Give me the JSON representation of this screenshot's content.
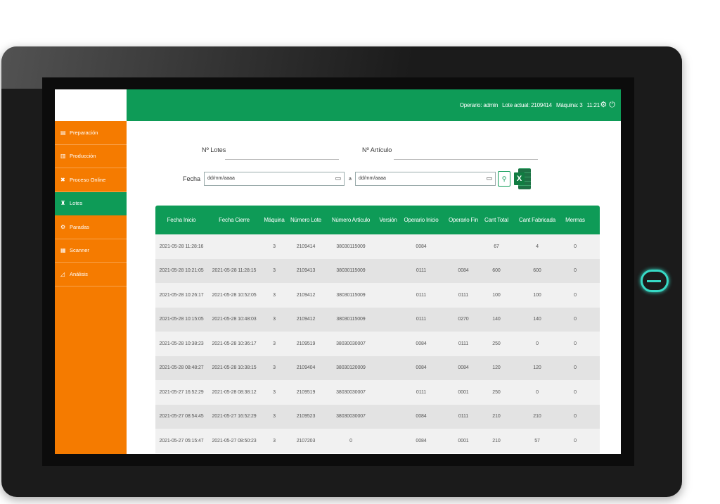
{
  "topbar": {
    "operator": "Operario: admin",
    "current_lot": "Lote actual: 2109414",
    "machine": "Máquina: 3",
    "time": "11:21",
    "settings_icon": "gear-icon",
    "power_icon": "power-icon"
  },
  "sidebar": {
    "items": [
      {
        "label": "Preparación",
        "icon": "file-icon"
      },
      {
        "label": "Producción",
        "icon": "bar-chart-icon"
      },
      {
        "label": "Proceso Online",
        "icon": "cross-icon"
      },
      {
        "label": "Lotes",
        "icon": "hierarchy-icon"
      },
      {
        "label": "Paradas",
        "icon": "gear-icon"
      },
      {
        "label": "Scanner",
        "icon": "barcode-icon"
      },
      {
        "label": "Análisis",
        "icon": "area-chart-icon"
      }
    ]
  },
  "filters": {
    "lotes_label": "Nº Lotes",
    "articulo_label": "Nº Artículo",
    "fecha_label": "Fecha",
    "date_from_placeholder": "dd/mm/aaaa",
    "separator": "a",
    "date_to_placeholder": "dd/mm/aaaa"
  },
  "table": {
    "headers": [
      "Fecha Inicio",
      "Fecha Cierre",
      "Máquina",
      "Número Lote",
      "Número Artículo",
      "Versión",
      "Operario Inicio",
      "Operario Fin",
      "Cant Total",
      "Cant Fabricada",
      "Mermas"
    ],
    "rows": [
      [
        "2021-05-28 11:28:16",
        "",
        "3",
        "2109414",
        "38030115009",
        "",
        "0084",
        "",
        "67",
        "4",
        "0"
      ],
      [
        "2021-05-28 10:21:05",
        "2021-05-28 11:28:15",
        "3",
        "2109413",
        "38030115009",
        "",
        "0111",
        "0084",
        "600",
        "600",
        "0"
      ],
      [
        "2021-05-28 10:26:17",
        "2021-05-28 10:52:05",
        "3",
        "2109412",
        "38030115009",
        "",
        "0111",
        "0111",
        "100",
        "100",
        "0"
      ],
      [
        "2021-05-28 10:15:05",
        "2021-05-28 10:48:03",
        "3",
        "2109412",
        "38030115009",
        "",
        "0111",
        "0270",
        "140",
        "140",
        "0"
      ],
      [
        "2021-05-28 10:38:23",
        "2021-05-28 10:36:17",
        "3",
        "2109519",
        "38030030007",
        "",
        "0084",
        "0111",
        "250",
        "0",
        "0"
      ],
      [
        "2021-05-28 08:48:27",
        "2021-05-28 10:38:15",
        "3",
        "2109404",
        "38030120009",
        "",
        "0084",
        "0084",
        "120",
        "120",
        "0"
      ],
      [
        "2021-05-27 16:52:29",
        "2021-05-28 08:38:12",
        "3",
        "2109519",
        "38030030007",
        "",
        "0111",
        "0001",
        "250",
        "0",
        "0"
      ],
      [
        "2021-05-27 08:54:45",
        "2021-05-27 16:52:29",
        "3",
        "2109523",
        "38030030007",
        "",
        "0084",
        "0111",
        "210",
        "210",
        "0"
      ],
      [
        "2021-05-27 05:15:47",
        "2021-05-27 08:50:23",
        "3",
        "2107203",
        "0",
        "",
        "0084",
        "0001",
        "210",
        "57",
        "0"
      ]
    ]
  }
}
